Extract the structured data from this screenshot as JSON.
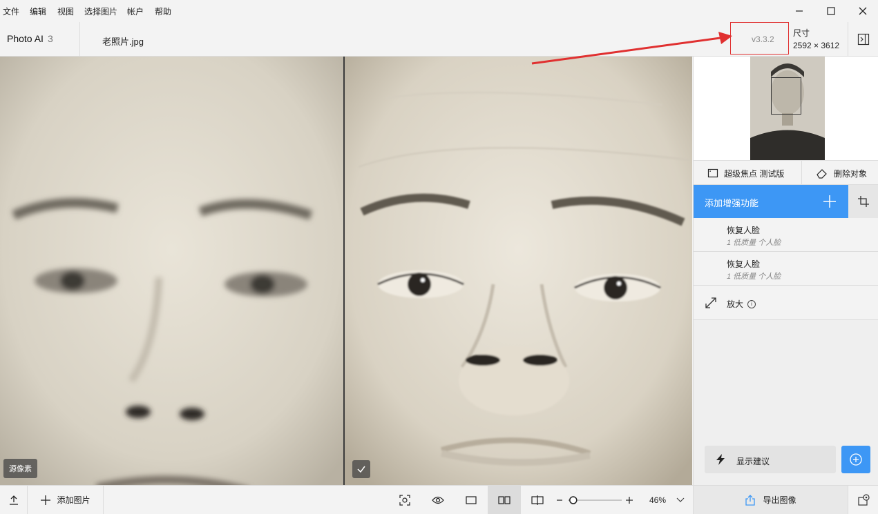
{
  "menubar": {
    "items": [
      "文件",
      "编辑",
      "视图",
      "选择图片",
      "帐户",
      "帮助"
    ]
  },
  "header": {
    "app_name": "Photo AI",
    "app_count": "3",
    "file_name": "老照片.jpg",
    "version": "v3.3.2",
    "dimension_label": "尺寸",
    "dimension_value": "2592 × 3612"
  },
  "viewer": {
    "left_label": "源像素"
  },
  "sidebar": {
    "tool_focus": "超级焦点 测试版",
    "tool_remove": "删除对象",
    "add_enhancement": "添加增强功能",
    "enhancements": [
      {
        "title": "恢复人脸",
        "subtitle": "1 低质量  个人脸"
      },
      {
        "title": "恢复人脸",
        "subtitle": "1 低质量  个人脸"
      }
    ],
    "upscale_label": "放大",
    "suggest_label": "显示建议"
  },
  "bottombar": {
    "add_image": "添加图片",
    "zoom": "46%",
    "zoom_level": 0.1,
    "export": "导出图像"
  },
  "colors": {
    "accent": "#3d97f5",
    "annotation": "#e03030"
  }
}
